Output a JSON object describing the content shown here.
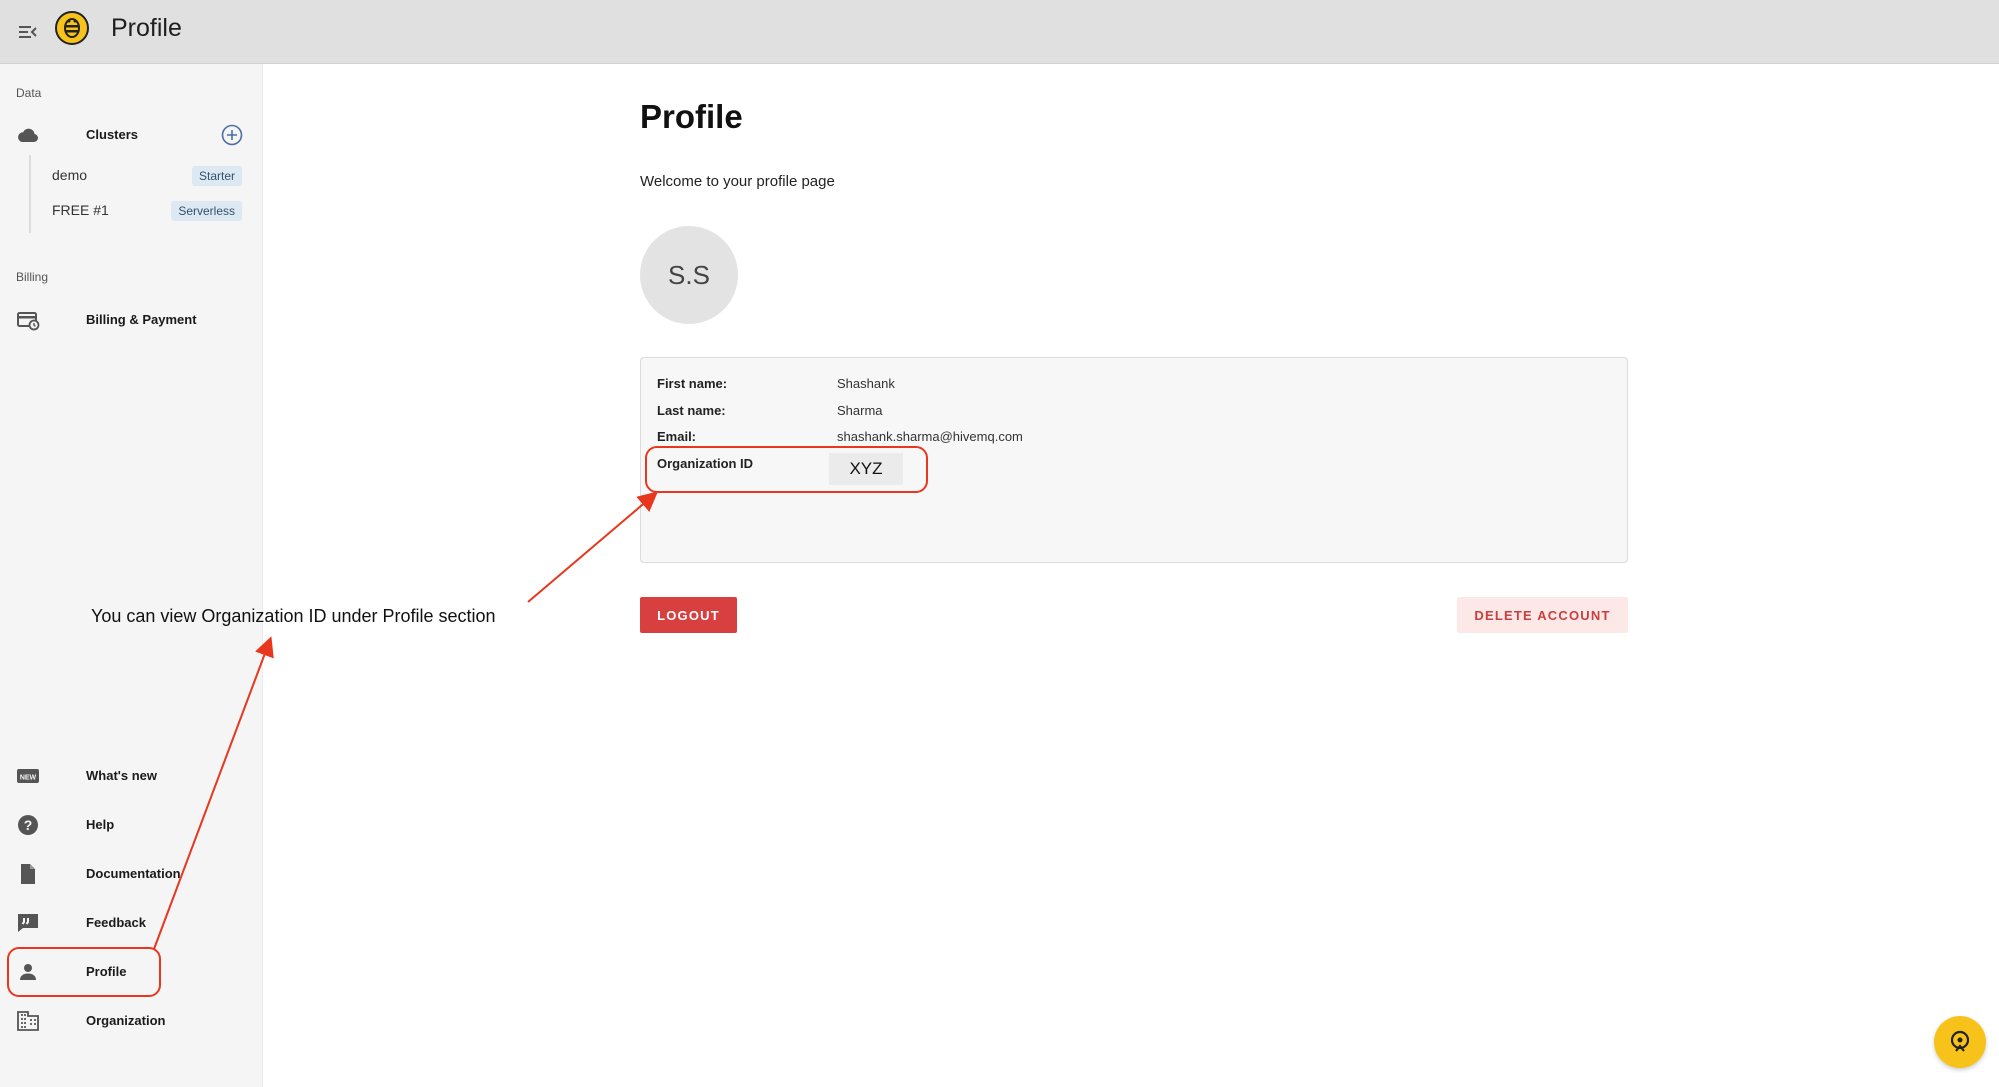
{
  "header": {
    "title": "Profile"
  },
  "sidebar": {
    "sections": {
      "data": "Data",
      "billing": "Billing"
    },
    "clusters": {
      "label": "Clusters",
      "items": [
        {
          "name": "demo",
          "badge": "Starter"
        },
        {
          "name": "FREE #1",
          "badge": "Serverless"
        }
      ]
    },
    "billing_item": "Billing & Payment",
    "bottom_items": [
      {
        "label": "What's new",
        "icon": "new-badge-icon"
      },
      {
        "label": "Help",
        "icon": "help-icon"
      },
      {
        "label": "Documentation",
        "icon": "document-icon"
      },
      {
        "label": "Feedback",
        "icon": "feedback-icon"
      },
      {
        "label": "Profile",
        "icon": "person-icon"
      },
      {
        "label": "Organization",
        "icon": "building-icon"
      }
    ]
  },
  "main": {
    "title": "Profile",
    "welcome": "Welcome to your profile page",
    "avatar_initials": "S.S",
    "fields": [
      {
        "label": "First name:",
        "value": "Shashank"
      },
      {
        "label": "Last name:",
        "value": "Sharma"
      },
      {
        "label": "Email:",
        "value": "shashank.sharma@hivemq.com"
      }
    ],
    "org": {
      "label": "Organization ID",
      "value": "XYZ"
    },
    "logout_label": "LOGOUT",
    "delete_label": "DELETE ACCOUNT"
  },
  "annotation": {
    "text": "You can view Organization ID under  Profile section",
    "color": "#e8361f"
  },
  "colors": {
    "primary_red": "#d84040",
    "fab_yellow": "#f7c31a"
  }
}
